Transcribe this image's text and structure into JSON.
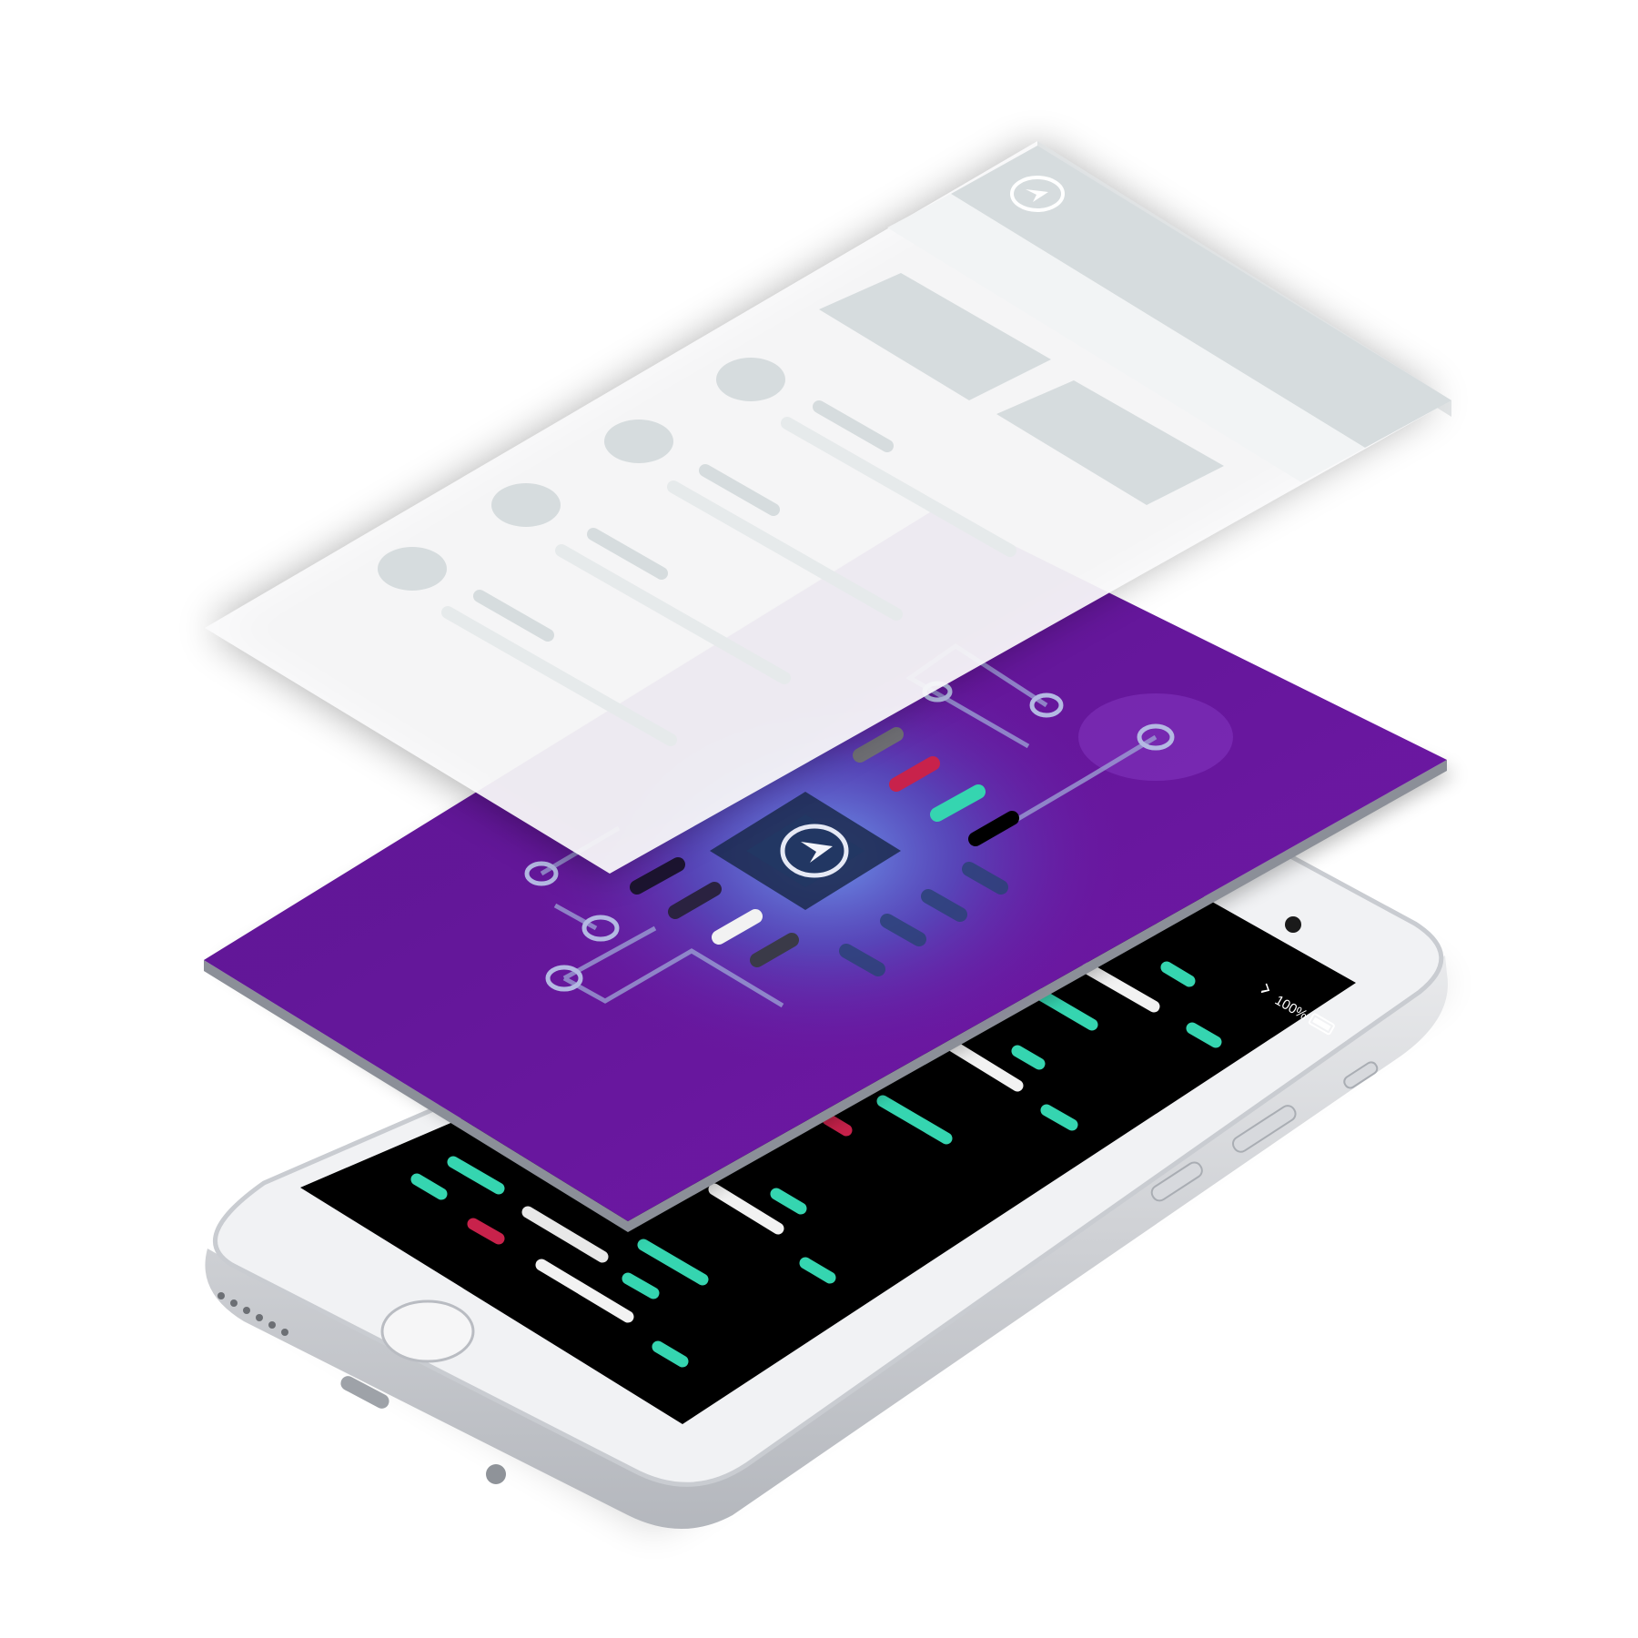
{
  "status_bar": {
    "battery_text": "100%"
  },
  "colors": {
    "phone_body": "#f1f2f4",
    "phone_rim": "#c9ccd1",
    "screen": "#000000",
    "purple_layer": "#6a1aa6",
    "glow": "#4f6fd6",
    "wireframe_layer": "#fbfbfc",
    "wireframe_block": "#d6dcde",
    "teal": "#35d5b0",
    "red": "#c8224b",
    "white_bar": "#f2f2f2",
    "grey_bar": "#7d7d82"
  },
  "icons": {
    "app_logo": "play-arrow-circle-icon",
    "home_button": "home-button-icon",
    "bluetooth": "bluetooth-icon",
    "battery": "battery-icon"
  }
}
